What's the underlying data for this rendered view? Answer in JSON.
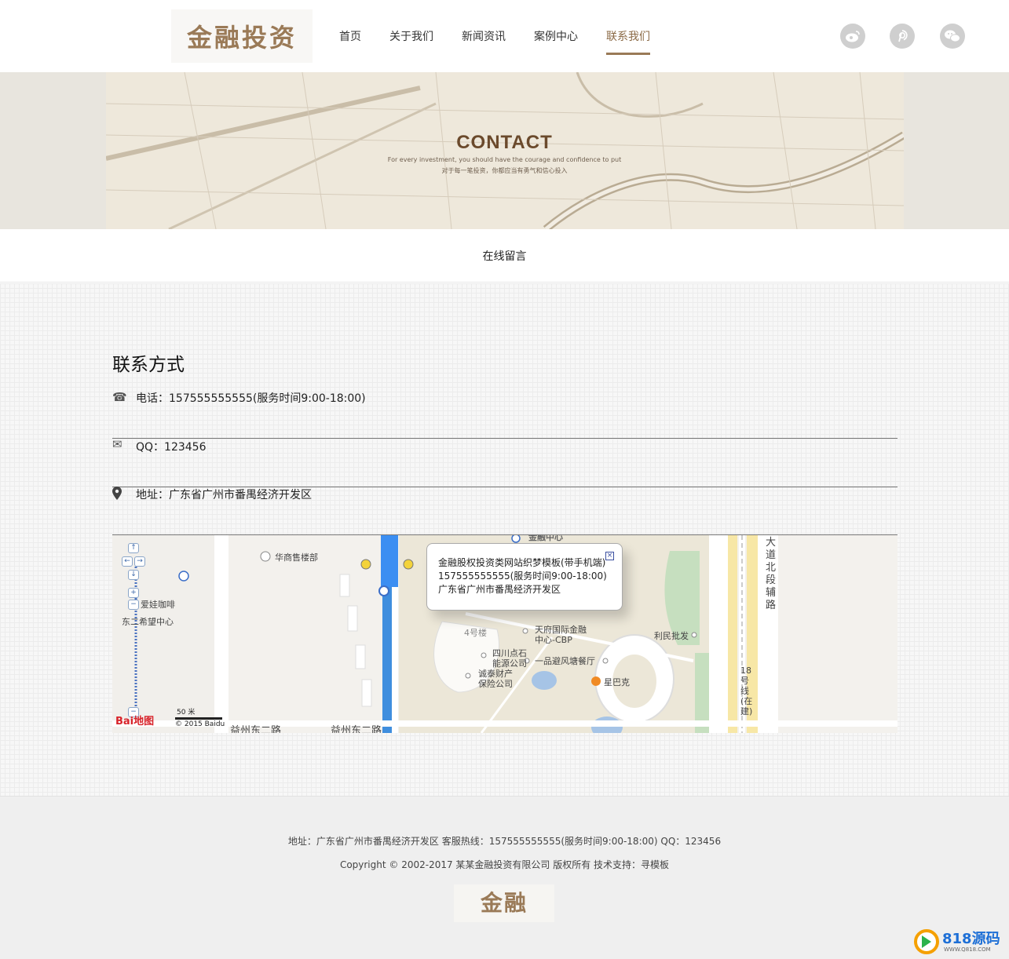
{
  "header": {
    "logo_text": "金融投资",
    "nav": [
      {
        "label": "首页"
      },
      {
        "label": "关于我们"
      },
      {
        "label": "新闻资讯"
      },
      {
        "label": "案例中心"
      },
      {
        "label": "联系我们"
      }
    ],
    "social_icons": [
      "weibo-icon",
      "pinterest-icon",
      "wechat-icon"
    ]
  },
  "banner": {
    "title": "CONTACT",
    "subtitle_en": "For every investment, you should have the courage and confidence to put",
    "subtitle_cn": "对于每一笔投资，你都应当有勇气和信心投入"
  },
  "tab": {
    "label": "在线留言"
  },
  "contact": {
    "title": "联系方式",
    "phone": "电话：157555555555(服务时间9:00-18:00)",
    "qq": "QQ：123456",
    "address": "地址：广东省广州市番禺经济开发区"
  },
  "map": {
    "popup_title": "金融股权投资类网站织梦模板(带手机端)",
    "popup_phone": "157555555555(服务时间9:00-18:00)",
    "popup_address": "广东省广州市番禺经济开发区",
    "labels": {
      "huashang": "华商售楼部",
      "aiwa": "爱娃咖啡",
      "xiwang": "东二希望中心",
      "building4": "4号楼",
      "tianfu": "天府国际金融",
      "tianfu2": "中心-CBP",
      "sichuan": "四川点石",
      "sichuan2": "能源公司",
      "chengtai": "诚泰财产",
      "chengtai2": "保险公司",
      "yipin": "一品避风塘餐厅",
      "xingbake": "星巴克",
      "limin": "利民批发",
      "road1": "益州东二路",
      "road2": "益州东二路",
      "dadao": "大道北段辅路",
      "line18": "18号线(在建)",
      "top_center": "金融中心"
    },
    "scale": "50 米",
    "copyright": "© 2015 Baidu",
    "brand": "Bai地图"
  },
  "footer": {
    "line1": "地址：广东省广州市番禺经济开发区 客服热线：157555555555(服务时间9:00-18:00) QQ：123456",
    "line2": "Copyright © 2002-2017 某某金融投资有限公司 版权所有 技术支持：寻模板",
    "logo_text": "金融"
  },
  "watermark": {
    "text": "818源码",
    "url": "WWW.Q818.COM"
  }
}
